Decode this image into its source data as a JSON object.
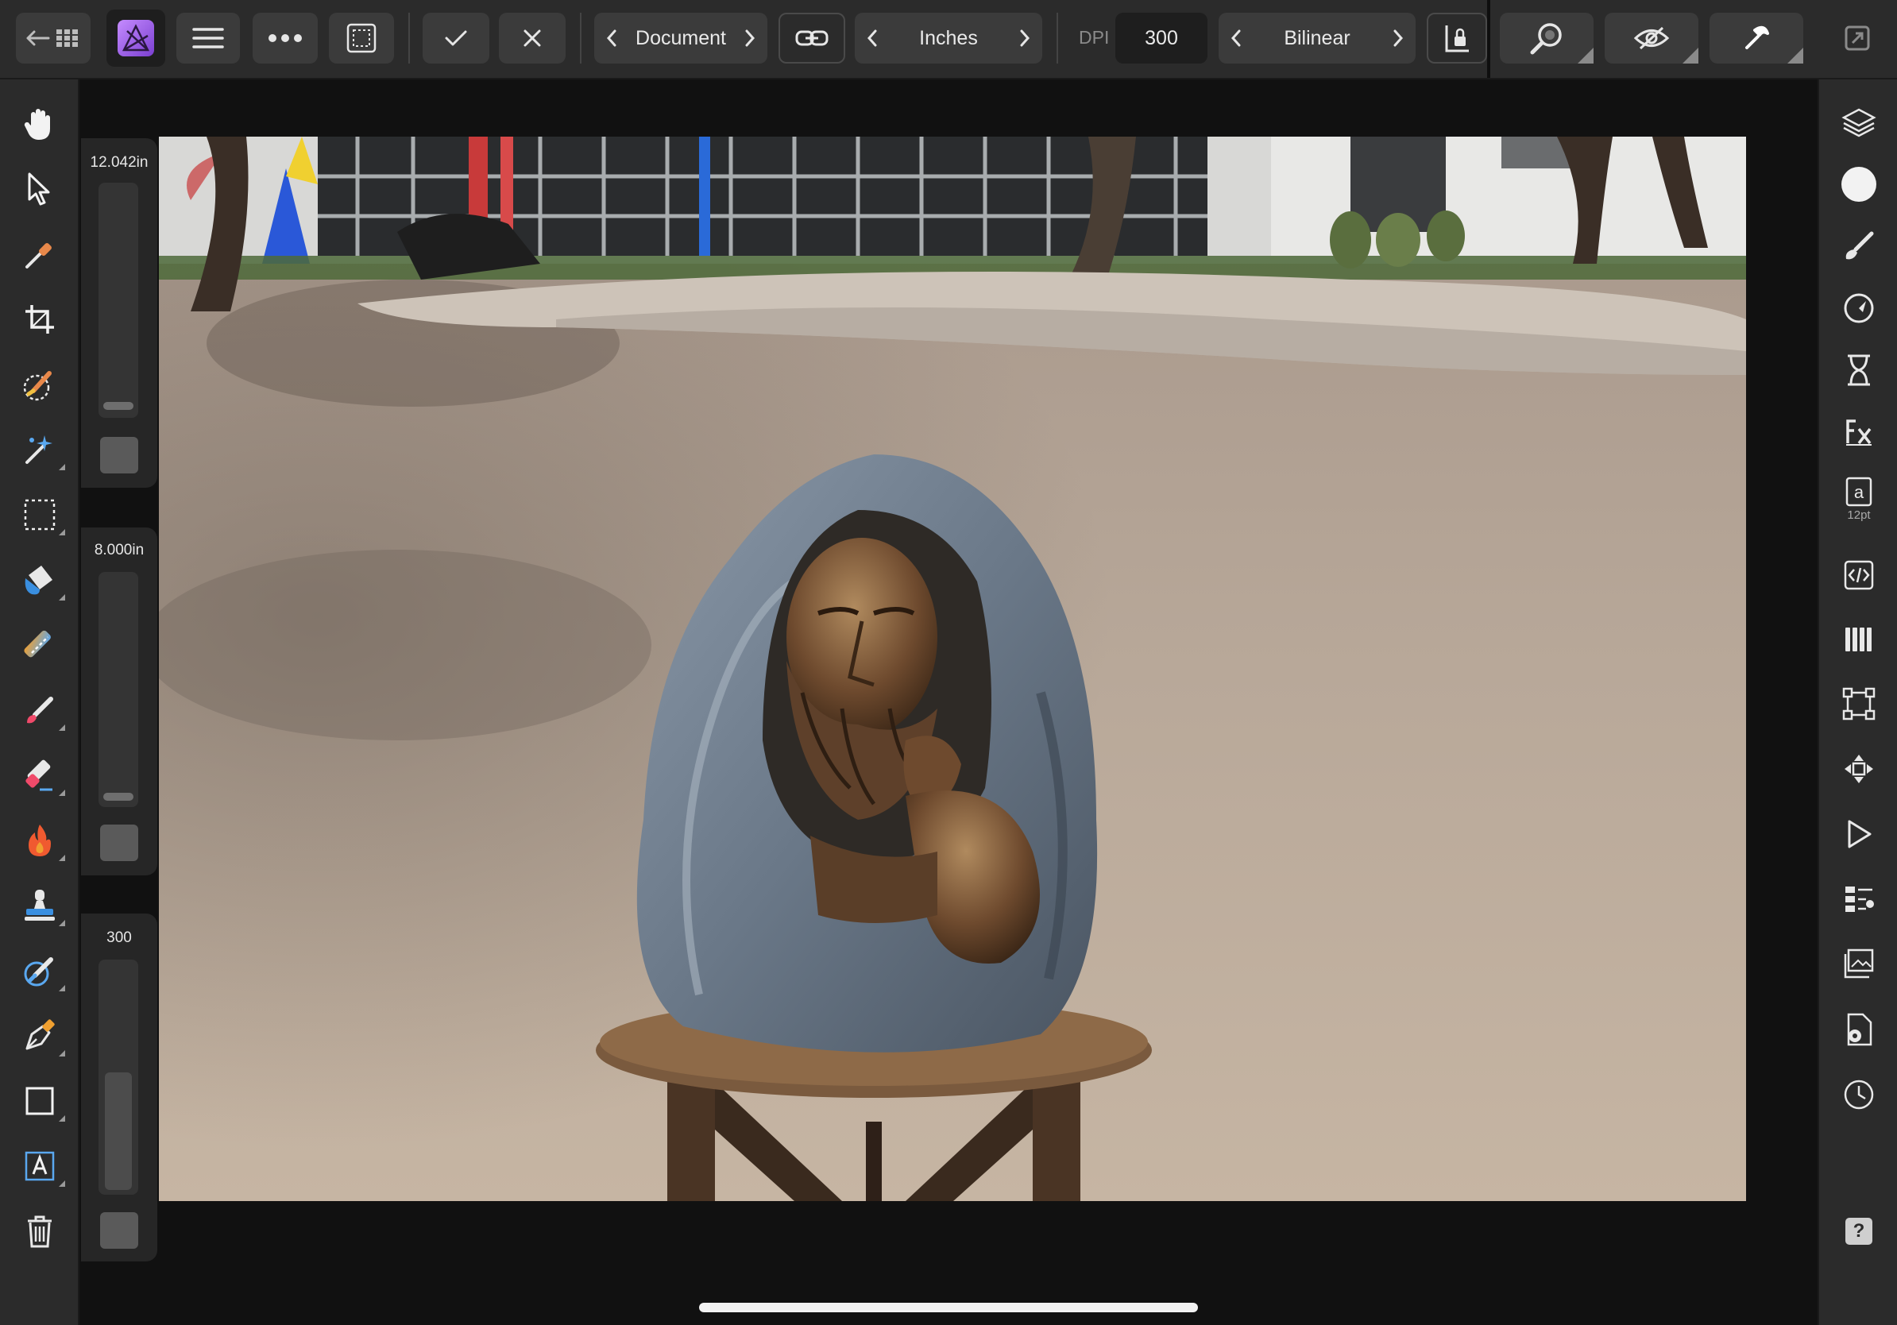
{
  "toolbar": {
    "persona_button": {
      "icon": "back-grid-icon"
    },
    "app_logo": {
      "icon": "affinity-photo-logo",
      "color": "#8e5bd8"
    },
    "menu_button": {
      "icon": "hamburger-icon"
    },
    "more_button": {
      "icon": "ellipsis-icon"
    },
    "selection_button": {
      "icon": "marquee-selection-icon"
    },
    "apply_button": {
      "icon": "checkmark-icon"
    },
    "cancel_button": {
      "icon": "close-icon"
    },
    "size_mode": {
      "value": "Document"
    },
    "link_button": {
      "icon": "link-icon"
    },
    "units": {
      "value": "Inches"
    },
    "dpi": {
      "label": "DPI",
      "value": "300"
    },
    "resample": {
      "value": "Bilinear"
    },
    "lock_button": {
      "icon": "lock-icon"
    },
    "zoom_button": {
      "icon": "magnifier-icon"
    },
    "view_button": {
      "icon": "eye-icon"
    },
    "assistant_button": {
      "icon": "assistant-icon"
    },
    "fullscreen_button": {
      "icon": "fullscreen-icon"
    }
  },
  "left_tools": [
    {
      "name": "view-tool",
      "icon": "hand-icon"
    },
    {
      "name": "move-tool",
      "icon": "pointer-icon"
    },
    {
      "name": "color-picker-tool",
      "icon": "eyedropper-icon"
    },
    {
      "name": "crop-tool",
      "icon": "crop-icon"
    },
    {
      "name": "selection-brush-tool",
      "icon": "selection-brush-icon"
    },
    {
      "name": "flood-select-tool",
      "icon": "magic-wand-icon"
    },
    {
      "name": "marquee-tool",
      "icon": "rectangle-marquee-icon"
    },
    {
      "name": "flood-fill-tool",
      "icon": "paint-bucket-icon"
    },
    {
      "name": "gradient-tool",
      "icon": "gradient-icon"
    },
    {
      "name": "paint-brush-tool",
      "icon": "paint-brush-icon"
    },
    {
      "name": "erase-brush-tool",
      "icon": "eraser-icon"
    },
    {
      "name": "dodge-brush-tool",
      "icon": "flame-icon"
    },
    {
      "name": "clone-brush-tool",
      "icon": "stamp-icon"
    },
    {
      "name": "healing-brush-tool",
      "icon": "healing-brush-icon"
    },
    {
      "name": "pen-tool",
      "icon": "pen-nib-icon"
    },
    {
      "name": "rectangle-tool",
      "icon": "rectangle-icon"
    },
    {
      "name": "artistic-text-tool",
      "icon": "text-icon"
    },
    {
      "name": "delete-tool",
      "icon": "trash-icon"
    }
  ],
  "sliders": {
    "width": {
      "label": "12.042in",
      "level": 0.05
    },
    "height": {
      "label": "8.000in",
      "level": 0.05
    },
    "dpi": {
      "label": "300",
      "level": 0.5
    }
  },
  "right_studio": [
    {
      "name": "layers-studio",
      "icon": "layers-icon"
    },
    {
      "name": "colour-studio",
      "icon": "color-circle-icon"
    },
    {
      "name": "brushes-studio",
      "icon": "brush-icon"
    },
    {
      "name": "adjustments-studio",
      "icon": "adjustment-dial-icon"
    },
    {
      "name": "history-studio",
      "icon": "hourglass-icon"
    },
    {
      "name": "fx-studio",
      "icon": "fx-icon"
    },
    {
      "name": "character-studio",
      "icon": "character-icon",
      "caption": "12pt",
      "glyph": "a"
    },
    {
      "name": "stock-studio",
      "icon": "code-brackets-icon"
    },
    {
      "name": "channels-studio",
      "icon": "channels-icon"
    },
    {
      "name": "transform-studio",
      "icon": "transform-icon"
    },
    {
      "name": "navigator-studio",
      "icon": "move-arrows-icon"
    },
    {
      "name": "macro-studio",
      "icon": "play-icon"
    },
    {
      "name": "library-studio",
      "icon": "library-list-icon"
    },
    {
      "name": "snapshots-studio",
      "icon": "snapshots-icon"
    },
    {
      "name": "document-settings-studio",
      "icon": "document-gear-icon"
    },
    {
      "name": "recorder-studio",
      "icon": "clock-icon"
    },
    {
      "name": "help",
      "icon": "help-icon",
      "glyph": "?"
    }
  ],
  "canvas": {
    "image_description_icon": "photo-bronze-sculpture"
  }
}
